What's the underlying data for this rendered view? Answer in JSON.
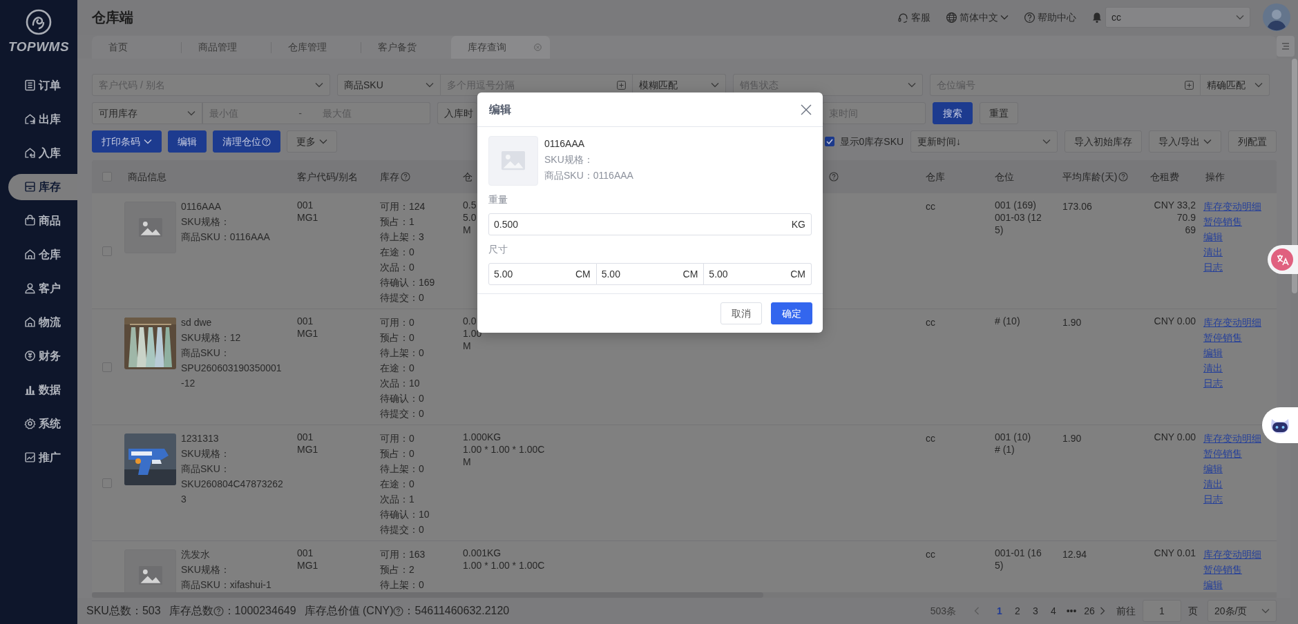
{
  "sidebar": {
    "brand": "TOPWMS",
    "items": [
      {
        "label": "订单",
        "selected": false
      },
      {
        "label": "出库",
        "selected": false
      },
      {
        "label": "入库",
        "selected": false
      },
      {
        "label": "库存",
        "selected": true
      },
      {
        "label": "商品",
        "selected": false
      },
      {
        "label": "仓库",
        "selected": false
      },
      {
        "label": "客户",
        "selected": false
      },
      {
        "label": "物流",
        "selected": false
      },
      {
        "label": "财务",
        "selected": false
      },
      {
        "label": "数据",
        "selected": false
      },
      {
        "label": "系统",
        "selected": false
      },
      {
        "label": "推广",
        "selected": false
      }
    ]
  },
  "header": {
    "title": "仓库端",
    "links": [
      {
        "label": "客服",
        "dropdown": false
      },
      {
        "label": "简体中文",
        "dropdown": true
      },
      {
        "label": "帮助中心",
        "dropdown": false
      }
    ],
    "account": "cc"
  },
  "tabs": [
    {
      "label": "首页",
      "selected": false,
      "closable": false
    },
    {
      "label": "商品管理",
      "selected": false,
      "closable": false
    },
    {
      "label": "仓库管理",
      "selected": false,
      "closable": false
    },
    {
      "label": "客户备货",
      "selected": false,
      "closable": false
    },
    {
      "label": "库存查询",
      "selected": true,
      "closable": true
    }
  ],
  "filters": [
    [
      {
        "kind": "select",
        "placeholder": "客户代码 / 别名"
      },
      {
        "kind": "group",
        "parts": [
          {
            "kind": "select",
            "value": "商品SKU"
          },
          {
            "kind": "batch-input",
            "placeholder": "多个用逗号分隔"
          },
          {
            "kind": "select",
            "value": "模糊匹配"
          }
        ]
      },
      {
        "kind": "select",
        "placeholder": "销售状态"
      },
      {
        "kind": "group",
        "parts": [
          {
            "kind": "batch-input",
            "placeholder": "仓位编号"
          },
          {
            "kind": "select",
            "value": "精确匹配"
          }
        ]
      }
    ],
    [
      {
        "kind": "group",
        "parts": [
          {
            "kind": "select",
            "value": "可用库存"
          },
          {
            "kind": "range",
            "min_placeholder": "最小值",
            "separator": "-",
            "max_placeholder": "最大值"
          }
        ]
      },
      {
        "kind": "text-field",
        "value": "入库时"
      },
      {
        "kind": "input",
        "placeholder": "束时间"
      },
      {
        "kind": "button",
        "label": "搜索",
        "primary": true
      },
      {
        "kind": "button",
        "label": "重置",
        "primary": false
      }
    ]
  ],
  "toolbar": {
    "buttons": [
      {
        "label": "打印条码",
        "primary": true,
        "dropdown": true,
        "help": false
      },
      {
        "label": "编辑",
        "primary": true,
        "dropdown": false,
        "help": false
      },
      {
        "label": "清理仓位",
        "primary": true,
        "dropdown": false,
        "help": true
      },
      {
        "label": "更多",
        "primary": false,
        "dropdown": true,
        "help": false
      }
    ],
    "show_zero": {
      "label": "显示0库存SKU",
      "checked": true
    },
    "sort": "更新时间↓",
    "actions": [
      {
        "label": "导入初始库存",
        "dropdown": false
      },
      {
        "label": "导入/导出",
        "dropdown": true
      },
      {
        "label": "列配置",
        "dropdown": false
      }
    ]
  },
  "table": {
    "all_selected": false,
    "columns": [
      {
        "label": "商品信息"
      },
      {
        "label": "客户代码/别名"
      },
      {
        "label": "库存",
        "help": true
      },
      {
        "label": "仓"
      },
      {
        "help": true
      },
      {
        "label": "仓库"
      },
      {
        "label": "仓位"
      },
      {
        "label": "平均库龄(天)",
        "help": true
      },
      {
        "label": "仓租费"
      },
      {
        "label": "操作"
      }
    ],
    "rows": [
      {
        "selected": false,
        "image": {
          "kind": "placeholder"
        },
        "product": [
          "0116AAA",
          "SKU规格：",
          "商品SKU：0116AAA"
        ],
        "customer": [
          "001",
          "MG1"
        ],
        "stock": [
          "可用：124",
          "预占：1",
          "待上架：3",
          "在途：0",
          "次品：0",
          "待确认：169",
          "待提交：0"
        ],
        "weight": [
          "0.5",
          "5.0",
          "M"
        ],
        "warehouse": "cc",
        "locations": [
          "001 (169)",
          "001-03 (125)"
        ],
        "age": "173.06",
        "rent": [
          "CNY 33,2",
          "70.9",
          "69"
        ],
        "actions": [
          "库存变动明细",
          "暂停销售",
          "编辑",
          "清出",
          "日志"
        ]
      },
      {
        "selected": false,
        "image": {
          "kind": "picture"
        },
        "product": [
          "sd dwe",
          "SKU规格：12",
          "商品SKU：SPU260603190350001-12"
        ],
        "customer": [
          "001",
          "MG1"
        ],
        "stock": [
          "可用：0",
          "预占：0",
          "待上架：0",
          "在途：0",
          "次品：10",
          "待确认：0",
          "待提交：0"
        ],
        "weight": [
          "0.0",
          "1.00",
          "M"
        ],
        "warehouse": "cc",
        "locations": [
          "# (10)"
        ],
        "age": "1.90",
        "rent": [
          "CNY 0.00"
        ],
        "actions": [
          "库存变动明细",
          "暂停销售",
          "编辑",
          "清出",
          "日志"
        ]
      },
      {
        "selected": false,
        "image": {
          "kind": "picture"
        },
        "product": [
          "1231313",
          "SKU规格：",
          "商品SKU：SKU260804C478732623"
        ],
        "customer": [
          "001",
          "MG1"
        ],
        "stock": [
          "可用：0",
          "预占：0",
          "待上架：0",
          "在途：0",
          "次品：1",
          "待确认：10",
          "待提交：0"
        ],
        "weight": [
          "1.000KG",
          "1.00 * 1.00 * 1.00C",
          "M"
        ],
        "warehouse": "cc",
        "locations": [
          "001 (10)",
          "# (1)"
        ],
        "age": "1.90",
        "rent": [
          "CNY 0.00"
        ],
        "actions": [
          "库存变动明细",
          "暂停销售",
          "编辑",
          "清出",
          "日志"
        ]
      },
      {
        "image": {
          "kind": "placeholder"
        },
        "product": [
          "洗发水",
          "SKU规格：",
          "商品SKU：xifashui-1"
        ],
        "customer": [
          "001",
          "MG1"
        ],
        "stock": [
          "可用：163",
          "预占：2",
          "待上架：0"
        ],
        "weight": [
          "0.001KG",
          "1.00 * 1.00 * 1.00C"
        ],
        "warehouse": "cc",
        "locations": [
          "001-01 (165)"
        ],
        "age": "12.94",
        "rent": [
          "CNY 0.01"
        ],
        "actions": [
          "库存变动明细",
          "暂停销售",
          "编辑"
        ]
      }
    ]
  },
  "summary": [
    {
      "label": "SKU总数",
      "help": false,
      "value": "：503"
    },
    {
      "label": "库存总数",
      "help": true,
      "value": "：1000234649"
    },
    {
      "label": "库存总价值 (CNY)",
      "help": true,
      "value": "：54611460632.2120"
    }
  ],
  "pagination": {
    "total": "503条",
    "pages": [
      {
        "label": "1",
        "selected": true
      },
      {
        "label": "2",
        "selected": false
      },
      {
        "label": "3",
        "selected": false
      },
      {
        "label": "4",
        "selected": false
      },
      {
        "label": "•••",
        "selected": false
      },
      {
        "label": "26",
        "selected": false
      }
    ],
    "goto_label": "前往",
    "goto_value": "1",
    "page_label": "页",
    "page_size": "20条/页"
  },
  "modal": {
    "title": "编辑",
    "product": [
      "0116AAA",
      "SKU规格：",
      "商品SKU：0116AAA"
    ],
    "weight": {
      "label": "重量",
      "value": "0.500",
      "unit": "KG"
    },
    "size": {
      "label": "尺寸",
      "fields": [
        {
          "value": "5.00",
          "unit": "CM"
        },
        {
          "value": "5.00",
          "unit": "CM"
        },
        {
          "value": "5.00",
          "unit": "CM"
        }
      ]
    },
    "buttons": [
      {
        "label": "取消",
        "primary": false
      },
      {
        "label": "确定",
        "primary": true
      }
    ]
  }
}
